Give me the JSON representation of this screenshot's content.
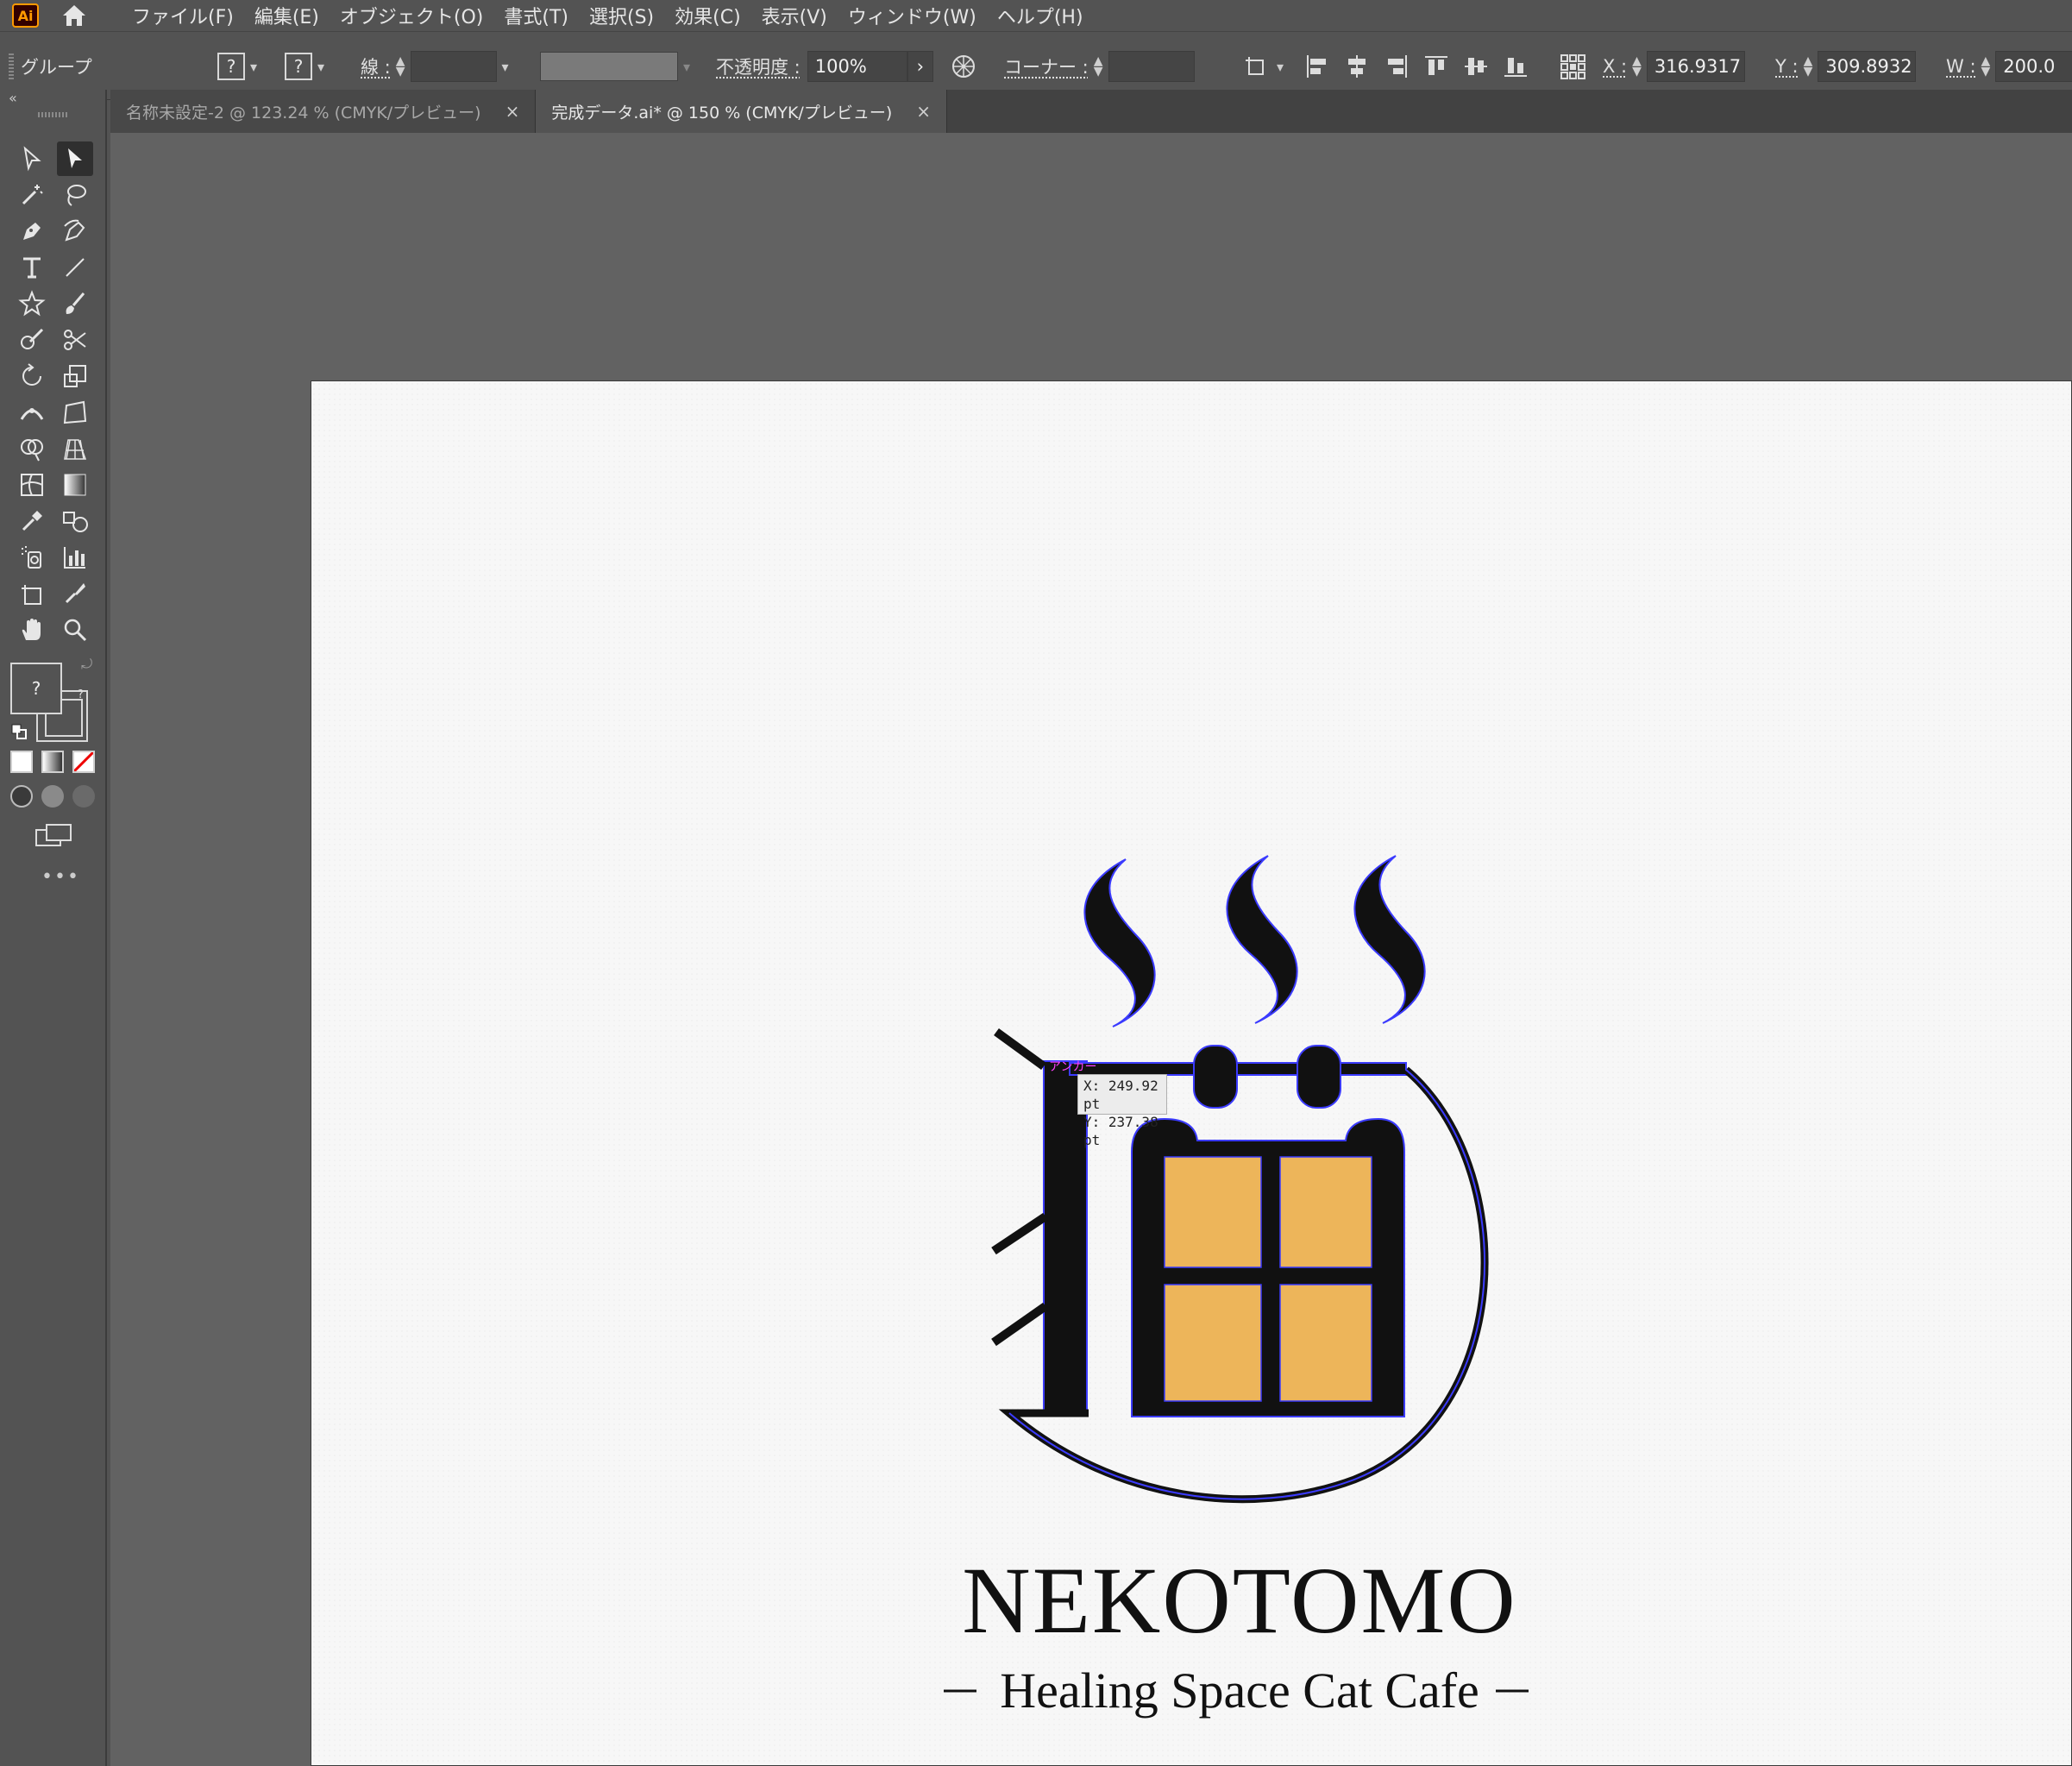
{
  "menubar": {
    "logo": "Ai",
    "items": [
      "ファイル(F)",
      "編集(E)",
      "オブジェクト(O)",
      "書式(T)",
      "選択(S)",
      "効果(C)",
      "表示(V)",
      "ウィンドウ(W)",
      "ヘルプ(H)"
    ]
  },
  "control": {
    "selection_type": "グループ",
    "fill_value": "?",
    "stroke_value": "?",
    "stroke_label": "線 :",
    "opacity_label": "不透明度 :",
    "opacity_value": "100%",
    "corner_label": "コーナー :",
    "x_label": "X :",
    "x_value": "316.9317",
    "y_label": "Y :",
    "y_value": "309.8932",
    "w_label": "W :",
    "w_value": "200.0"
  },
  "tabs": [
    {
      "label": "名称未設定-2 @ 123.24 % (CMYK/プレビュー)",
      "close": "×",
      "active": false
    },
    {
      "label": "完成データ.ai* @ 150 % (CMYK/プレビュー)",
      "close": "×",
      "active": true
    }
  ],
  "toolbar": {
    "fill_indicator": "?",
    "stroke_indicator": "?",
    "more": "•••"
  },
  "canvas": {
    "tooltip_x": "X: 249.92 pt",
    "tooltip_y": "Y: 237.38 pt",
    "anchor_label": "アンカー"
  },
  "artwork": {
    "title": "NEKOTOMO",
    "subtitle": "Healing Space Cat Cafe",
    "colors": {
      "ink": "#111111",
      "window": "#edb55a",
      "selection": "#3b3bff"
    }
  }
}
